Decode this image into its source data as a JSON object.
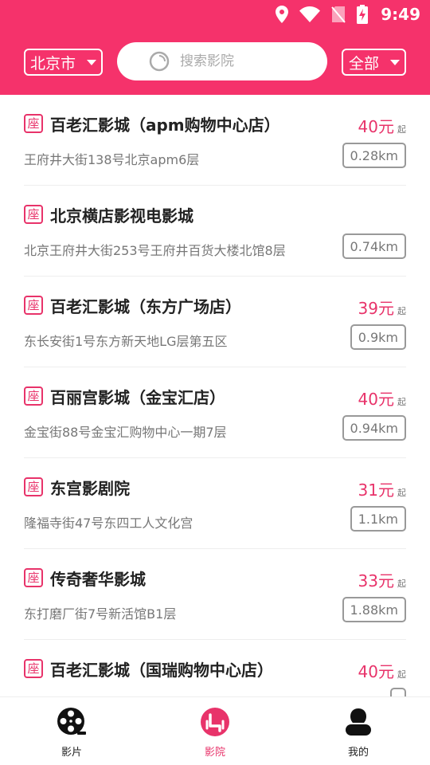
{
  "status": {
    "time": "9:49"
  },
  "header": {
    "city": "北京市",
    "search_placeholder": "搜索影院",
    "filter": "全部"
  },
  "colors": {
    "brand": "#f5326b",
    "accent": "#e8336a"
  },
  "cinemas": [
    {
      "badge": "座",
      "name": "百老汇影城（apm购物中心店）",
      "price": "40元",
      "price_suffix": "起",
      "address": "王府井大街138号北京apm6层",
      "distance": "0.28km"
    },
    {
      "badge": "座",
      "name": "北京横店影视电影城",
      "price": "",
      "price_suffix": "",
      "address": "北京王府井大街253号王府井百货大楼北馆8层",
      "distance": "0.74km"
    },
    {
      "badge": "座",
      "name": "百老汇影城（东方广场店）",
      "price": "39元",
      "price_suffix": "起",
      "address": "东长安街1号东方新天地LG层第五区",
      "distance": "0.9km"
    },
    {
      "badge": "座",
      "name": "百丽宫影城（金宝汇店）",
      "price": "40元",
      "price_suffix": "起",
      "address": "金宝街88号金宝汇购物中心一期7层",
      "distance": "0.94km"
    },
    {
      "badge": "座",
      "name": "东宫影剧院",
      "price": "31元",
      "price_suffix": "起",
      "address": "隆福寺街47号东四工人文化宫",
      "distance": "1.1km"
    },
    {
      "badge": "座",
      "name": "传奇奢华影城",
      "price": "33元",
      "price_suffix": "起",
      "address": "东打磨厂街7号新活馆B1层",
      "distance": "1.88km"
    },
    {
      "badge": "座",
      "name": "百老汇影城（国瑞购物中心店）",
      "price": "40元",
      "price_suffix": "起",
      "address": "",
      "distance": ""
    }
  ],
  "tabs": [
    {
      "label": "影片",
      "icon": "film-reel-icon"
    },
    {
      "label": "影院",
      "icon": "cinema-seat-icon",
      "active": true
    },
    {
      "label": "我的",
      "icon": "user-icon"
    }
  ]
}
